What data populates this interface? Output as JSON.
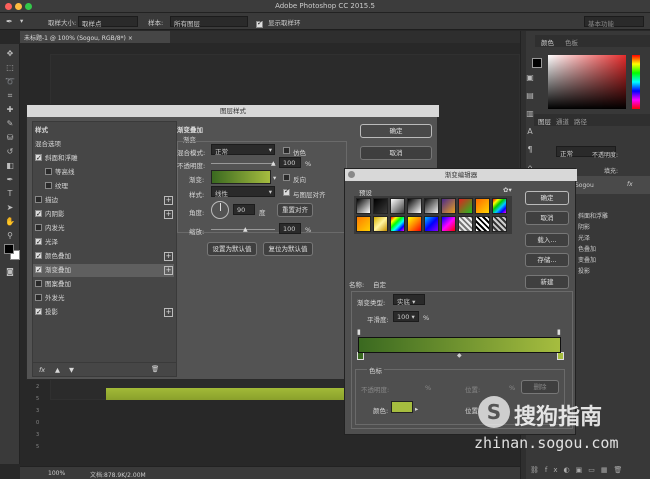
{
  "app": {
    "title": "Adobe Photoshop CC 2015.5"
  },
  "options_bar": {
    "sample_size_label": "取样大小:",
    "sample_size_value": "取样点",
    "sample_label": "样本:",
    "sample_value": "所有图层",
    "show_ring_label": "显示取样环",
    "workspace": "基本功能"
  },
  "document": {
    "tab": "未标题-1 @ 100% (Sogou, RGB/8*)",
    "zoom": "100%",
    "doc_info": "文档:878.9K/2.00M",
    "ruler_marks": [
      "5",
      "1",
      "0",
      "1",
      "5",
      "2",
      "0",
      "2",
      "5",
      "3",
      "0",
      "3",
      "5"
    ]
  },
  "panels": {
    "color_tab": "颜色",
    "swatches_tab": "色板",
    "layers_tab": "图层",
    "channels_tab": "通道",
    "paths_tab": "路径",
    "blend_mode": "正常",
    "opacity_label": "不透明度:",
    "fill_label": "填充:",
    "layer_name": "Sogou",
    "fx": "fx",
    "effects": [
      "斜面和浮雕",
      "阴影",
      "光泽",
      "色叠加",
      "变叠加",
      "投影"
    ]
  },
  "layer_style": {
    "title": "图层样式",
    "list_header": "样式",
    "blend_options": "混合选项",
    "items": [
      {
        "label": "斜面和浮雕",
        "checked": true,
        "plus": false
      },
      {
        "label": "等高线",
        "checked": false,
        "plus": false,
        "indent": true
      },
      {
        "label": "纹理",
        "checked": false,
        "plus": false,
        "indent": true
      },
      {
        "label": "描边",
        "checked": false,
        "plus": true
      },
      {
        "label": "内阴影",
        "checked": true,
        "plus": true
      },
      {
        "label": "内发光",
        "checked": false,
        "plus": false
      },
      {
        "label": "光泽",
        "checked": true,
        "plus": false
      },
      {
        "label": "颜色叠加",
        "checked": true,
        "plus": true
      },
      {
        "label": "渐变叠加",
        "checked": true,
        "plus": true
      },
      {
        "label": "图案叠加",
        "checked": false,
        "plus": false
      },
      {
        "label": "外发光",
        "checked": false,
        "plus": false
      },
      {
        "label": "投影",
        "checked": true,
        "plus": true
      }
    ],
    "footer_icons": [
      "fx",
      "▲",
      "▼",
      "🗑"
    ],
    "section_title": "渐变叠加",
    "section_sub": "渐变",
    "blend_mode_label": "混合模式:",
    "blend_mode_value": "正常",
    "dither_label": "仿色",
    "opacity_label": "不透明度:",
    "opacity_value": "100",
    "percent": "%",
    "gradient_label": "渐变:",
    "reverse_label": "反向",
    "style_label": "样式:",
    "style_value": "线性",
    "align_label": "与图层对齐",
    "angle_label": "角度:",
    "angle_value": "90",
    "degree": "度",
    "reset_align": "重置对齐",
    "scale_label": "缩放:",
    "scale_value": "100",
    "set_default": "设置为默认值",
    "reset_default": "复位为默认值",
    "ok": "确定",
    "cancel": "取消"
  },
  "gradient_editor": {
    "title": "渐变编辑器",
    "presets_label": "预设",
    "ok": "确定",
    "cancel": "取消",
    "load": "载入...",
    "save": "存储...",
    "new": "新建",
    "name_label": "名称:",
    "name_value": "自定",
    "type_label": "渐变类型:",
    "type_value": "实底",
    "smooth_label": "平滑度:",
    "smooth_value": "100",
    "percent": "%",
    "stops_label": "色标",
    "stop_opacity_label": "不透明度:",
    "stop_location_label": "位置:",
    "delete_label": "删除",
    "color_label": "颜色:",
    "location_label2": "位置",
    "stop_color": "#a6bd3f",
    "gradient_start": "#3a6920",
    "gradient_end": "#a6bd3f"
  },
  "watermark": {
    "brand": "搜狗指南",
    "url": "zhinan.sogou.com"
  }
}
